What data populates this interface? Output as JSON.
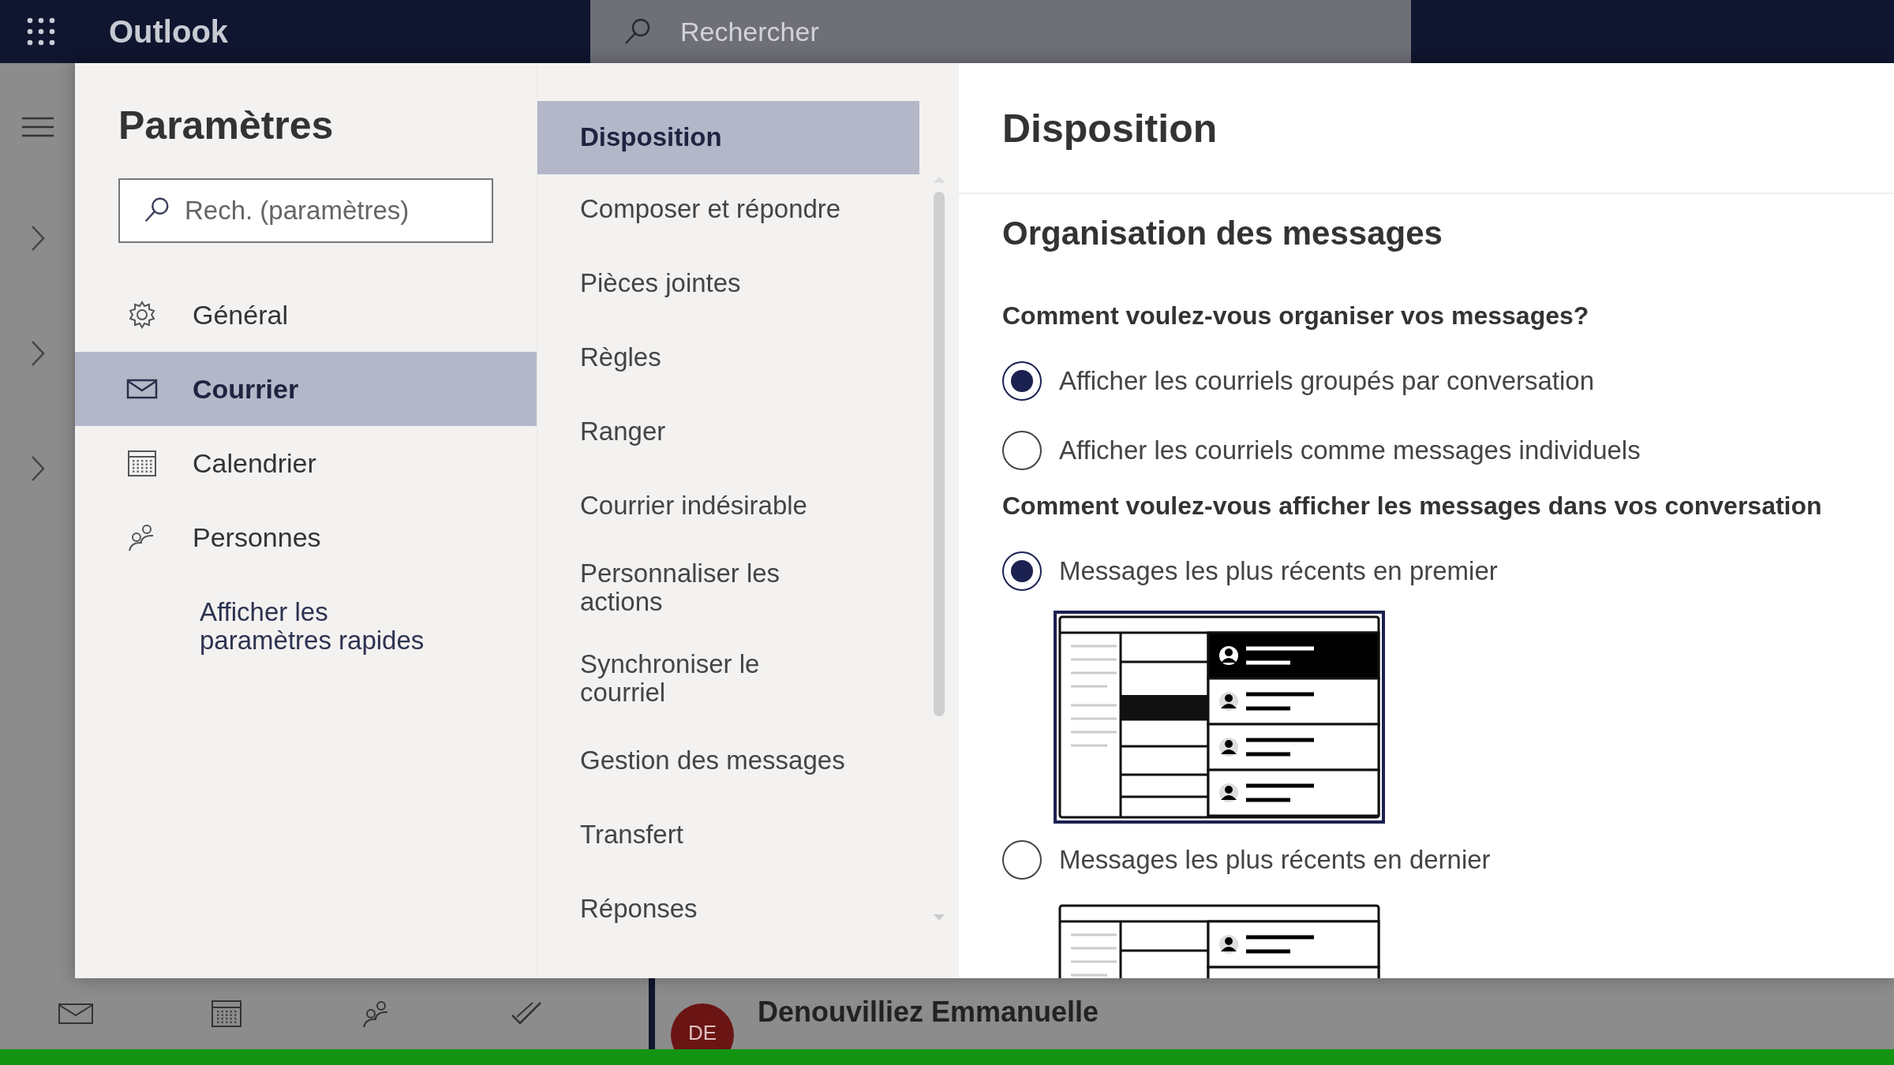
{
  "app_bar": {
    "title": "Outlook",
    "search": {
      "placeholder": "Rechercher"
    }
  },
  "settings": {
    "title": "Paramètres",
    "search": {
      "placeholder": "Rech. (paramètres)"
    },
    "categories": [
      {
        "label": "Général",
        "selected": false
      },
      {
        "label": "Courrier",
        "selected": true
      },
      {
        "label": "Calendrier",
        "selected": false
      },
      {
        "label": "Personnes",
        "selected": false
      }
    ],
    "quick_settings_link": "Afficher les\nparamètres rapides",
    "subcategories": [
      {
        "label": "Disposition",
        "selected": true
      },
      {
        "label": "Composer et répondre",
        "selected": false
      },
      {
        "label": "Pièces jointes",
        "selected": false
      },
      {
        "label": "Règles",
        "selected": false
      },
      {
        "label": "Ranger",
        "selected": false
      },
      {
        "label": "Courrier indésirable",
        "selected": false
      },
      {
        "label": "Personnaliser les\nactions",
        "selected": false
      },
      {
        "label": "Synchroniser le\ncourriel",
        "selected": false
      },
      {
        "label": "Gestion des messages",
        "selected": false
      },
      {
        "label": "Transfert",
        "selected": false
      },
      {
        "label": "Réponses",
        "selected": false
      }
    ],
    "content": {
      "title": "Disposition",
      "section": "Organisation des messages",
      "groups": [
        {
          "question": "Comment voulez-vous organiser vos messages?",
          "options": [
            {
              "label": "Afficher les courriels groupés par conversation",
              "selected": true
            },
            {
              "label": "Afficher les courriels comme messages individuels",
              "selected": false
            }
          ]
        },
        {
          "question": "Comment voulez-vous afficher les messages dans vos conversation",
          "options": [
            {
              "label": "Messages les plus récents en premier",
              "selected": true,
              "kind": "newest_first"
            },
            {
              "label": "Messages les plus récents en dernier",
              "selected": false,
              "kind": "newest_last"
            }
          ]
        }
      ]
    }
  },
  "message_list": {
    "avatar": "DE",
    "sender": "Denouvilliez Emmanuelle"
  }
}
